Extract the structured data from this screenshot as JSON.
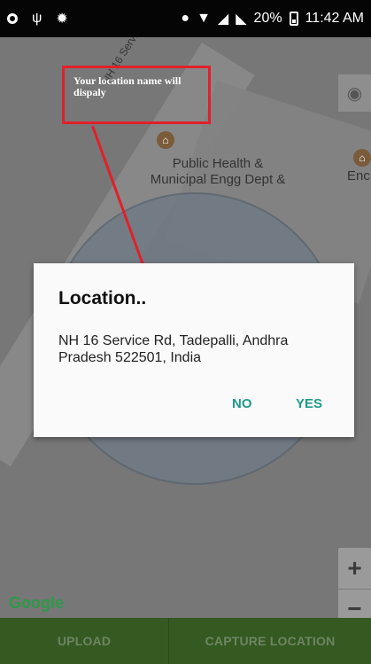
{
  "status_bar": {
    "battery": "20%",
    "time": "11:42 AM"
  },
  "map": {
    "road_name": "NH 16 Service Rd",
    "poi_1": "Public Health & Municipal Engg Dept &",
    "poi_2": "Enc",
    "callout_text": "Your location name will dispaly",
    "attribution": "Google",
    "zoom_in": "+",
    "zoom_out": "−"
  },
  "dialog": {
    "title": "Location..",
    "message": "NH 16 Service Rd, Tadepalli, Andhra Pradesh 522501, India",
    "no_label": "NO",
    "yes_label": "YES"
  },
  "bottom_bar": {
    "upload_label": "UPLOAD",
    "capture_label": "CAPTURE LOCATION"
  },
  "colors": {
    "accent": "#1e9b8a",
    "callout_red": "#e0202b",
    "bottom_bar": "#345a22"
  }
}
